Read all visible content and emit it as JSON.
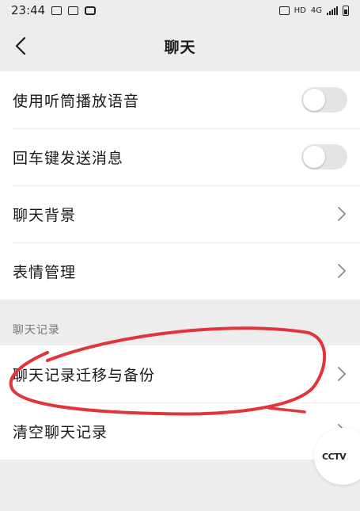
{
  "status_bar": {
    "time": "23:44",
    "network": "4G",
    "hd_label": "HD"
  },
  "nav": {
    "title": "聊天"
  },
  "settings": {
    "toggles": [
      {
        "label": "使用听筒播放语音",
        "on": false
      },
      {
        "label": "回车键发送消息",
        "on": false
      }
    ],
    "links": [
      {
        "label": "聊天背景"
      },
      {
        "label": "表情管理"
      }
    ]
  },
  "chat_history": {
    "section_label": "聊天记录",
    "items": [
      {
        "label": "聊天记录迁移与备份"
      },
      {
        "label": "清空聊天记录"
      }
    ]
  },
  "colors": {
    "toggle_off": "#e4e4e4",
    "annotation_red": "#e0353b"
  },
  "icons": {
    "back": "chevron-left-icon",
    "row_arrow": "chevron-right-icon"
  }
}
